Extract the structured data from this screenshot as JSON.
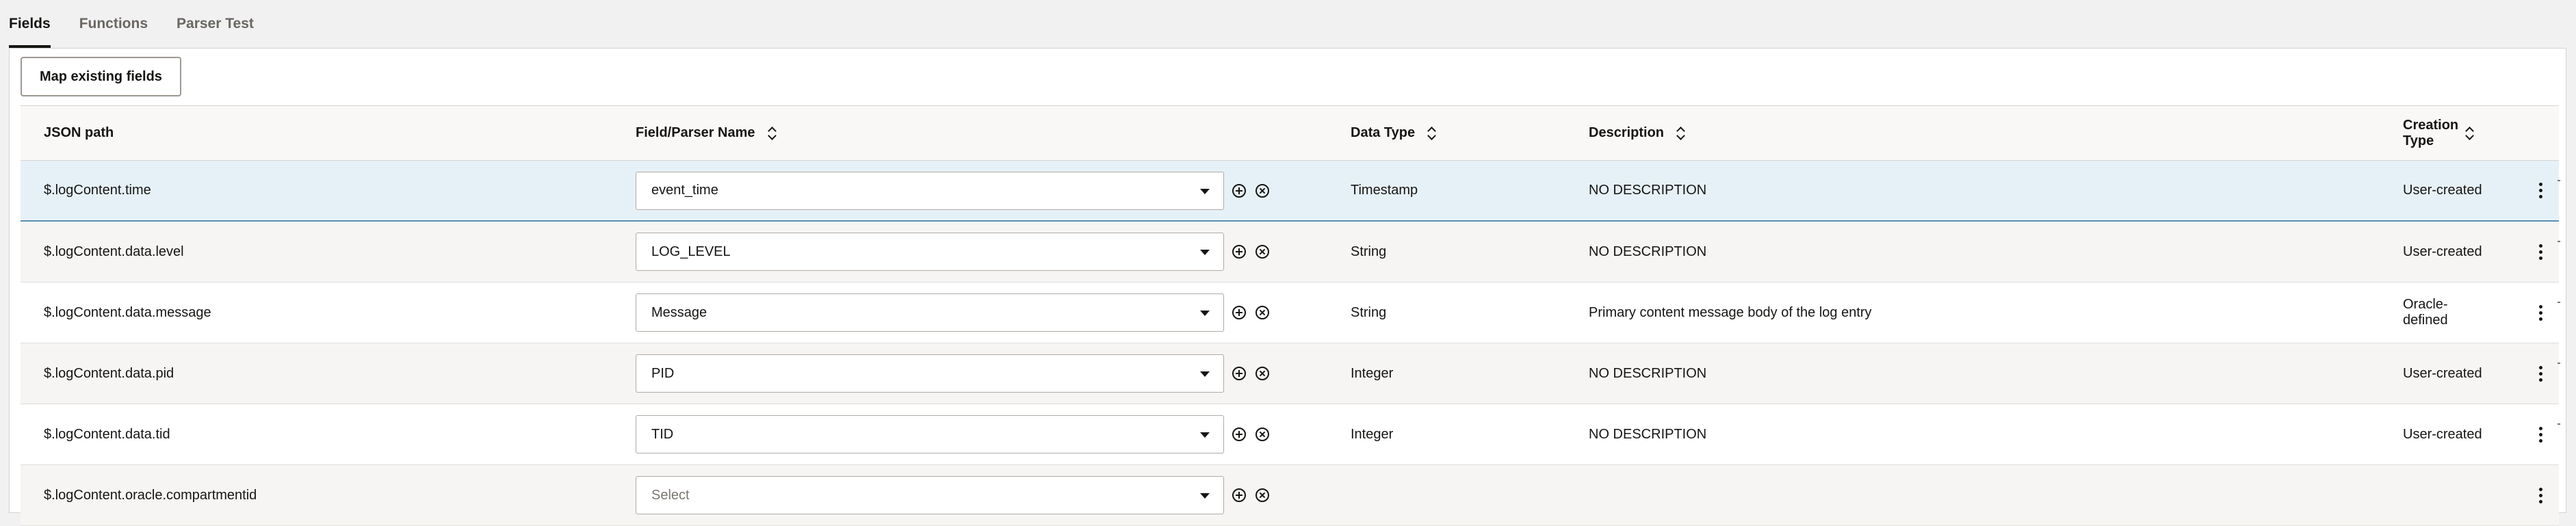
{
  "tabs": [
    {
      "label": "Fields",
      "active": true
    },
    {
      "label": "Functions",
      "active": false
    },
    {
      "label": "Parser Test",
      "active": false
    }
  ],
  "toolbar": {
    "map_button_label": "Map existing fields"
  },
  "table": {
    "headers": {
      "json_path": "JSON path",
      "field_parser_name": "Field/Parser Name",
      "data_type": "Data Type",
      "description": "Description",
      "creation_type_line1": "Creation",
      "creation_type_line2": "Type"
    },
    "rows": [
      {
        "json_path": "$.logContent.time",
        "field": "event_time",
        "data_type": "Timestamp",
        "description": "NO DESCRIPTION",
        "creation_line1": "User-created",
        "creation_line2": ""
      },
      {
        "json_path": "$.logContent.data.level",
        "field": "LOG_LEVEL",
        "data_type": "String",
        "description": "NO DESCRIPTION",
        "creation_line1": "User-created",
        "creation_line2": ""
      },
      {
        "json_path": "$.logContent.data.message",
        "field": "Message",
        "data_type": "String",
        "description": "Primary content message body of the log entry",
        "creation_line1": "Oracle-",
        "creation_line2": "defined"
      },
      {
        "json_path": "$.logContent.data.pid",
        "field": "PID",
        "data_type": "Integer",
        "description": "NO DESCRIPTION",
        "creation_line1": "User-created",
        "creation_line2": ""
      },
      {
        "json_path": "$.logContent.data.tid",
        "field": "TID",
        "data_type": "Integer",
        "description": "NO DESCRIPTION",
        "creation_line1": "User-created",
        "creation_line2": ""
      },
      {
        "json_path": "$.logContent.oracle.compartmentid",
        "field": "",
        "field_placeholder": "Select",
        "data_type": "",
        "description": "",
        "creation_line1": "",
        "creation_line2": ""
      }
    ]
  },
  "colors": {
    "selected_row_bg": "#e6f1f7",
    "selected_row_border": "#5b8fb3",
    "alt_row_bg": "#f6f5f4"
  }
}
